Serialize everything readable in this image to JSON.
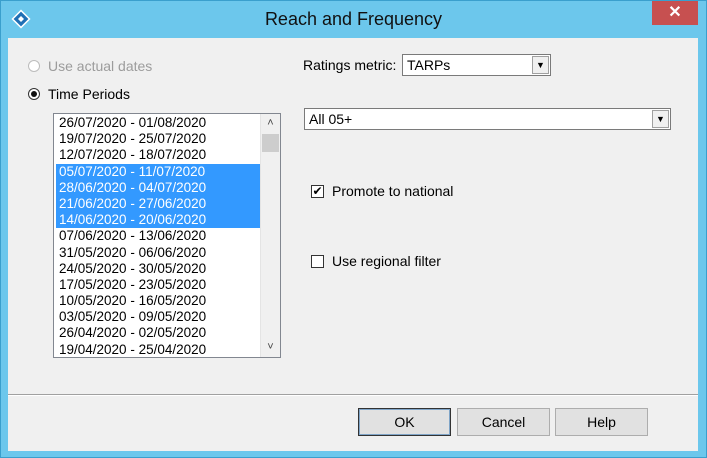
{
  "window": {
    "title": "Reach and Frequency",
    "close_label": "✕"
  },
  "period_mode": {
    "actual_dates_label": "Use actual dates",
    "time_periods_label": "Time Periods"
  },
  "periods": [
    "26/07/2020 - 01/08/2020",
    "19/07/2020 - 25/07/2020",
    "12/07/2020 - 18/07/2020",
    "05/07/2020 - 11/07/2020",
    "28/06/2020 - 04/07/2020",
    "21/06/2020 - 27/06/2020",
    "14/06/2020 - 20/06/2020",
    "07/06/2020 - 13/06/2020",
    "31/05/2020 - 06/06/2020",
    "24/05/2020 - 30/05/2020",
    "17/05/2020 - 23/05/2020",
    "10/05/2020 - 16/05/2020",
    "03/05/2020 - 09/05/2020",
    "26/04/2020 - 02/05/2020",
    "19/04/2020 - 25/04/2020"
  ],
  "selected_periods": [
    3,
    4,
    5,
    6
  ],
  "ratings": {
    "label": "Ratings metric:",
    "value": "TARPs"
  },
  "audience": {
    "value": "All 05+"
  },
  "options": {
    "promote_label": "Promote to national",
    "promote_checked": true,
    "regional_label": "Use regional filter",
    "regional_checked": false
  },
  "buttons": {
    "ok": "OK",
    "cancel": "Cancel",
    "help": "Help"
  },
  "colors": {
    "titlebar": "#6cc7ec",
    "selection": "#3399ff",
    "close": "#c75050"
  }
}
